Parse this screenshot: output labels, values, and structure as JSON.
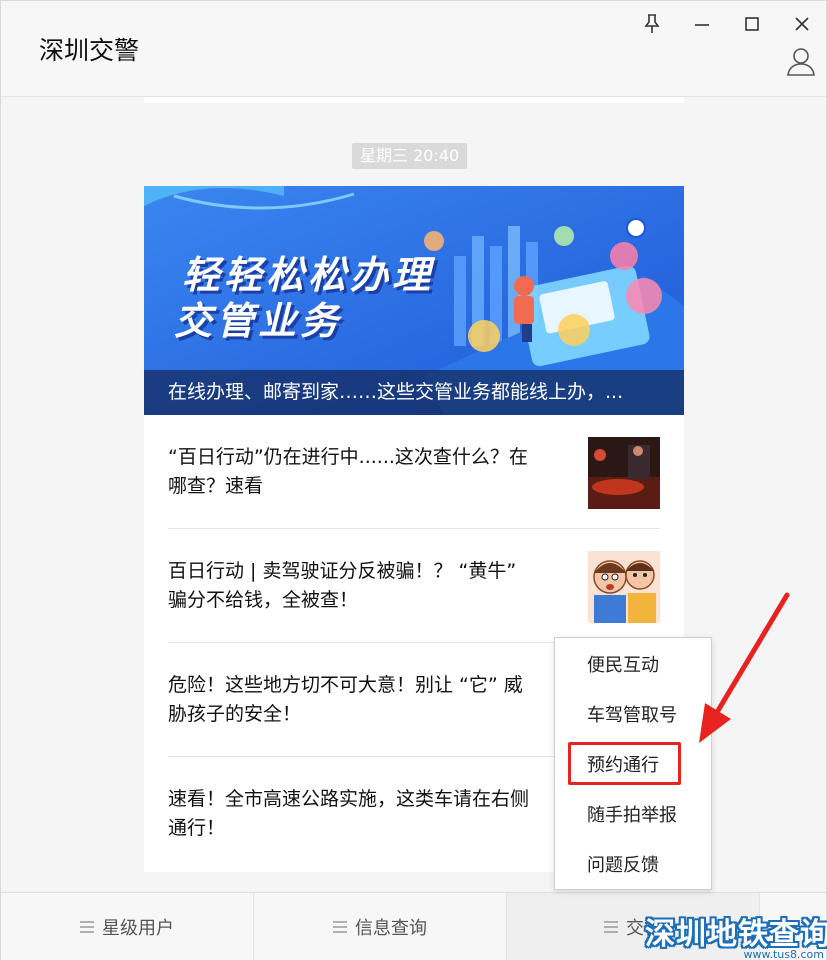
{
  "window": {
    "title": "深圳交警",
    "controls": {
      "pin": "pin-icon",
      "minimize": "minimize-icon",
      "maximize": "maximize-icon",
      "close": "close-icon",
      "profile": "person-icon"
    }
  },
  "chat": {
    "timestamp": "星期三  20:40",
    "banner": {
      "headline_line1": "轻轻松松办理",
      "headline_line2": "交管业务",
      "caption": "在线办理、邮寄到家……这些交管业务都能线上办，..."
    },
    "articles": [
      {
        "title_line1": "“百日行动”仍在进行中......这次查什么？在",
        "title_line2": "哪查？速看"
      },
      {
        "title_line1": "百日行动 | 卖驾驶证分反被骗！？ “黄牛”",
        "title_line2": "骗分不给钱，全被查！"
      },
      {
        "title_line1": "危险！这些地方切不可大意！别让 “它” 威",
        "title_line2": "胁孩子的安全！"
      },
      {
        "title_line1": "速看！全市高速公路实施，这类车请在右侧",
        "title_line2": "通行！"
      }
    ]
  },
  "menu": {
    "tabs": [
      {
        "label": "星级用户"
      },
      {
        "label": "信息查询"
      },
      {
        "label": "交警"
      }
    ],
    "popup_items": [
      "便民互动",
      "车驾管取号",
      "预约通行",
      "随手拍举报",
      "问题反馈"
    ]
  },
  "watermark": {
    "text": "深圳地铁查询",
    "url": "www.tus8.com"
  },
  "colors": {
    "highlight": "#e8231f",
    "banner_blue": "#2a6fe0",
    "watermark_blue": "#1b6fb8"
  }
}
